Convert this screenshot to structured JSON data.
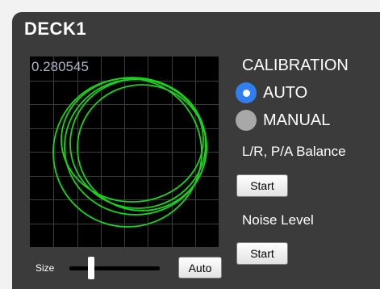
{
  "deck": {
    "title": "DECK1"
  },
  "scope": {
    "value": "0.280545",
    "grid_color": "#3c3c3c",
    "trace_color": "#19d21c"
  },
  "size_control": {
    "label": "Size",
    "level": 0.22,
    "auto_label": "Auto"
  },
  "calibration": {
    "title": "CALIBRATION",
    "options": [
      {
        "label": "AUTO",
        "selected": true
      },
      {
        "label": "MANUAL",
        "selected": false
      }
    ],
    "accent": "#2f7ff0"
  },
  "balance": {
    "label": "L/R, P/A Balance",
    "button_label": "Start"
  },
  "noise": {
    "label": "Noise Level",
    "button_label": "Start"
  }
}
